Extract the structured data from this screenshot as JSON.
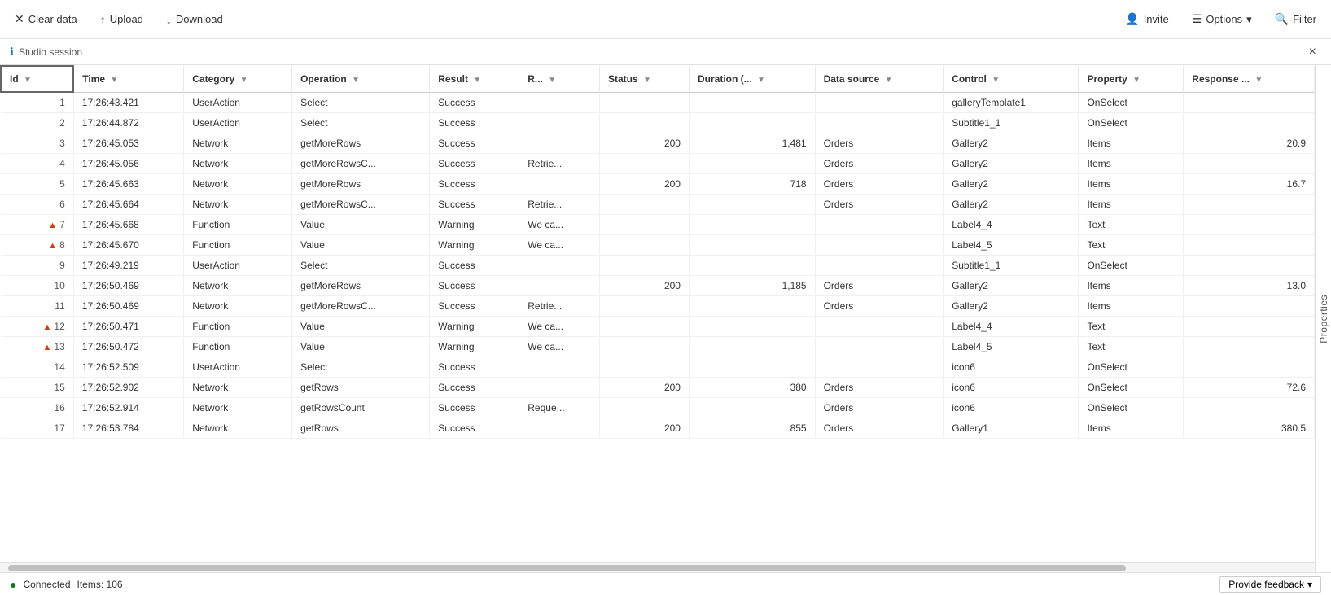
{
  "toolbar": {
    "clear_label": "Clear data",
    "upload_label": "Upload",
    "download_label": "Download",
    "invite_label": "Invite",
    "options_label": "Options",
    "filter_label": "Filter"
  },
  "session": {
    "label": "Studio session",
    "close_label": "×"
  },
  "side_panel": {
    "label": "Properties",
    "chevron": "❯"
  },
  "columns": [
    {
      "id": "id",
      "label": "Id",
      "sort": "▼"
    },
    {
      "id": "time",
      "label": "Time",
      "sort": "▼"
    },
    {
      "id": "category",
      "label": "Category",
      "sort": "▼"
    },
    {
      "id": "operation",
      "label": "Operation",
      "sort": "▼"
    },
    {
      "id": "result",
      "label": "Result",
      "sort": "▼"
    },
    {
      "id": "r",
      "label": "R...",
      "sort": "▼"
    },
    {
      "id": "status",
      "label": "Status",
      "sort": "▼"
    },
    {
      "id": "duration",
      "label": "Duration (...",
      "sort": "▼"
    },
    {
      "id": "datasource",
      "label": "Data source",
      "sort": "▼"
    },
    {
      "id": "control",
      "label": "Control",
      "sort": "▼"
    },
    {
      "id": "property",
      "label": "Property",
      "sort": "▼"
    },
    {
      "id": "response",
      "label": "Response ...",
      "sort": "▼"
    }
  ],
  "rows": [
    {
      "id": 1,
      "time": "17:26:43.421",
      "category": "UserAction",
      "operation": "Select",
      "result": "Success",
      "r": "",
      "status": "",
      "duration": "",
      "datasource": "",
      "control": "galleryTemplate1",
      "property": "OnSelect",
      "response": "",
      "warn": false
    },
    {
      "id": 2,
      "time": "17:26:44.872",
      "category": "UserAction",
      "operation": "Select",
      "result": "Success",
      "r": "",
      "status": "",
      "duration": "",
      "datasource": "",
      "control": "Subtitle1_1",
      "property": "OnSelect",
      "response": "",
      "warn": false
    },
    {
      "id": 3,
      "time": "17:26:45.053",
      "category": "Network",
      "operation": "getMoreRows",
      "result": "Success",
      "r": "",
      "status": "200",
      "duration": "1,481",
      "datasource": "Orders",
      "control": "Gallery2",
      "property": "Items",
      "response": "20.9",
      "warn": false
    },
    {
      "id": 4,
      "time": "17:26:45.056",
      "category": "Network",
      "operation": "getMoreRowsC...",
      "result": "Success",
      "r": "Retrie...",
      "status": "",
      "duration": "",
      "datasource": "Orders",
      "control": "Gallery2",
      "property": "Items",
      "response": "",
      "warn": false
    },
    {
      "id": 5,
      "time": "17:26:45.663",
      "category": "Network",
      "operation": "getMoreRows",
      "result": "Success",
      "r": "",
      "status": "200",
      "duration": "718",
      "datasource": "Orders",
      "control": "Gallery2",
      "property": "Items",
      "response": "16.7",
      "warn": false
    },
    {
      "id": 6,
      "time": "17:26:45.664",
      "category": "Network",
      "operation": "getMoreRowsC...",
      "result": "Success",
      "r": "Retrie...",
      "status": "",
      "duration": "",
      "datasource": "Orders",
      "control": "Gallery2",
      "property": "Items",
      "response": "",
      "warn": false
    },
    {
      "id": 7,
      "time": "17:26:45.668",
      "category": "Function",
      "operation": "Value",
      "result": "Warning",
      "r": "We ca...",
      "status": "",
      "duration": "",
      "datasource": "",
      "control": "Label4_4",
      "property": "Text",
      "response": "",
      "warn": true
    },
    {
      "id": 8,
      "time": "17:26:45.670",
      "category": "Function",
      "operation": "Value",
      "result": "Warning",
      "r": "We ca...",
      "status": "",
      "duration": "",
      "datasource": "",
      "control": "Label4_5",
      "property": "Text",
      "response": "",
      "warn": true
    },
    {
      "id": 9,
      "time": "17:26:49.219",
      "category": "UserAction",
      "operation": "Select",
      "result": "Success",
      "r": "",
      "status": "",
      "duration": "",
      "datasource": "",
      "control": "Subtitle1_1",
      "property": "OnSelect",
      "response": "",
      "warn": false
    },
    {
      "id": 10,
      "time": "17:26:50.469",
      "category": "Network",
      "operation": "getMoreRows",
      "result": "Success",
      "r": "",
      "status": "200",
      "duration": "1,185",
      "datasource": "Orders",
      "control": "Gallery2",
      "property": "Items",
      "response": "13.0",
      "warn": false
    },
    {
      "id": 11,
      "time": "17:26:50.469",
      "category": "Network",
      "operation": "getMoreRowsC...",
      "result": "Success",
      "r": "Retrie...",
      "status": "",
      "duration": "",
      "datasource": "Orders",
      "control": "Gallery2",
      "property": "Items",
      "response": "",
      "warn": false
    },
    {
      "id": 12,
      "time": "17:26:50.471",
      "category": "Function",
      "operation": "Value",
      "result": "Warning",
      "r": "We ca...",
      "status": "",
      "duration": "",
      "datasource": "",
      "control": "Label4_4",
      "property": "Text",
      "response": "",
      "warn": true
    },
    {
      "id": 13,
      "time": "17:26:50.472",
      "category": "Function",
      "operation": "Value",
      "result": "Warning",
      "r": "We ca...",
      "status": "",
      "duration": "",
      "datasource": "",
      "control": "Label4_5",
      "property": "Text",
      "response": "",
      "warn": true
    },
    {
      "id": 14,
      "time": "17:26:52.509",
      "category": "UserAction",
      "operation": "Select",
      "result": "Success",
      "r": "",
      "status": "",
      "duration": "",
      "datasource": "",
      "control": "icon6",
      "property": "OnSelect",
      "response": "",
      "warn": false
    },
    {
      "id": 15,
      "time": "17:26:52.902",
      "category": "Network",
      "operation": "getRows",
      "result": "Success",
      "r": "",
      "status": "200",
      "duration": "380",
      "datasource": "Orders",
      "control": "icon6",
      "property": "OnSelect",
      "response": "72.6",
      "warn": false
    },
    {
      "id": 16,
      "time": "17:26:52.914",
      "category": "Network",
      "operation": "getRowsCount",
      "result": "Success",
      "r": "Reque...",
      "status": "",
      "duration": "",
      "datasource": "Orders",
      "control": "icon6",
      "property": "OnSelect",
      "response": "",
      "warn": false
    },
    {
      "id": 17,
      "time": "17:26:53.784",
      "category": "Network",
      "operation": "getRows",
      "result": "Success",
      "r": "",
      "status": "200",
      "duration": "855",
      "datasource": "Orders",
      "control": "Gallery1",
      "property": "Items",
      "response": "380.5",
      "warn": false
    }
  ],
  "status": {
    "connected_label": "Connected",
    "items_label": "Items: 106",
    "feedback_label": "Provide feedback",
    "feedback_icon": "▾"
  }
}
